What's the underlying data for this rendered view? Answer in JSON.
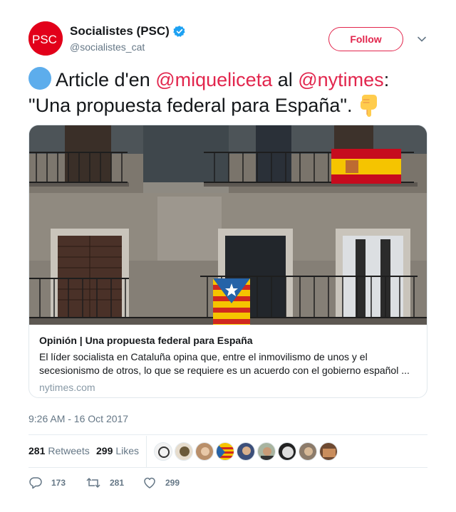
{
  "author": {
    "name": "Socialistes (PSC)",
    "handle": "@socialistes_cat",
    "avatar_text": "PSC",
    "brand_color": "#e2001a",
    "verified_icon": "verified-badge-icon"
  },
  "follow_label": "Follow",
  "tweet": {
    "part1": "Article d'en ",
    "mention1": "@miqueliceta",
    "part2": " al ",
    "mention2": "@nytimes",
    "part3": ":",
    "part4": "\"Una propuesta federal para España\".",
    "leading_emoji": "blue-circle-emoji",
    "trailing_emoji": "backhand-index-pointing-down-emoji",
    "mention_color": "#e2264d"
  },
  "card": {
    "title": "Opinión | Una propuesta federal para España",
    "description": "El líder socialista en Cataluña opina que, entre el inmovilismo de unos y el secesionismo de otros, lo que se requiere es un acuerdo con el gobierno español ...",
    "domain": "nytimes.com"
  },
  "timestamp": "9:26 AM - 16 Oct 2017",
  "stats": {
    "retweets_count": "281",
    "retweets_label": "Retweets",
    "likes_count": "299",
    "likes_label": "Likes"
  },
  "actions": {
    "replies": "173",
    "retweets": "281",
    "likes": "299"
  }
}
